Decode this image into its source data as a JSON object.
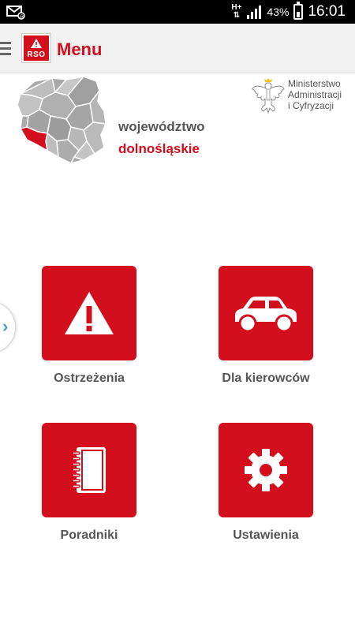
{
  "status": {
    "battery": "43%",
    "time": "16:01",
    "network": "H+"
  },
  "appbar": {
    "logo_text": "RSO",
    "title": "Menu"
  },
  "region": {
    "label": "województwo",
    "name": "dolnośląskie"
  },
  "ministry": {
    "line1": "Ministerstwo",
    "line2": "Administracji",
    "line3": "i Cyfryzacji"
  },
  "tiles": [
    {
      "label": "Ostrzeżenia",
      "icon": "warning-icon"
    },
    {
      "label": "Dla kierowców",
      "icon": "car-icon"
    },
    {
      "label": "Poradniki",
      "icon": "notebook-icon"
    },
    {
      "label": "Ustawienia",
      "icon": "gear-icon"
    }
  ],
  "colors": {
    "accent": "#d30e1d",
    "text": "#555555",
    "handle": "#4a9fd3"
  }
}
